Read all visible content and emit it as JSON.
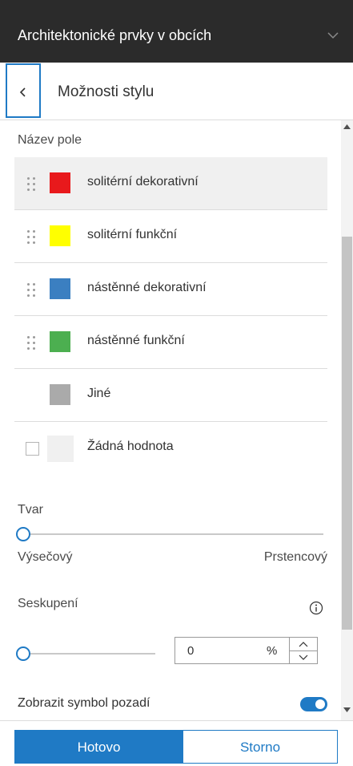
{
  "header": {
    "title": "Architektonické prvky v obcích"
  },
  "subheader": {
    "title": "Možnosti stylu"
  },
  "field": {
    "label": "Název pole"
  },
  "categories": [
    {
      "label": "solitérní dekorativní",
      "color": "#e8191c"
    },
    {
      "label": "solitérní funkční",
      "color": "#ffff00"
    },
    {
      "label": "nástěnné dekorativní",
      "color": "#3b7fc1"
    },
    {
      "label": "nástěnné funkční",
      "color": "#4caf50"
    },
    {
      "label": "Jiné",
      "color": "#aaaaaa"
    },
    {
      "label": "Žádná hodnota",
      "color": "#f0f0f0",
      "checked": false
    }
  ],
  "shape": {
    "label": "Tvar",
    "min_label": "Výsečový",
    "max_label": "Prstencový",
    "value": 0
  },
  "grouping": {
    "label": "Seskupení",
    "value": "0",
    "unit": "%"
  },
  "background_symbol": {
    "label": "Zobrazit symbol pozadí",
    "enabled": true
  },
  "footer": {
    "done_label": "Hotovo",
    "cancel_label": "Storno"
  },
  "colors": {
    "accent": "#1f7ac5",
    "header_bg": "#2b2b2b"
  }
}
